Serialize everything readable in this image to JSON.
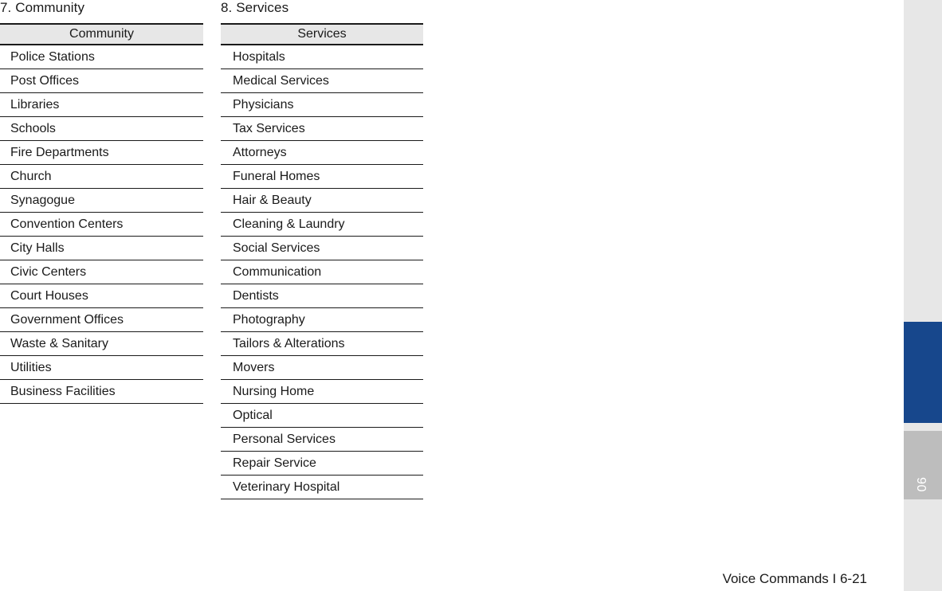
{
  "sections": [
    {
      "number_title": "7. Community",
      "table_header": "Community",
      "rows": [
        "Police Stations",
        "Post Offices",
        "Libraries",
        "Schools",
        "Fire Departments",
        "Church",
        "Synagogue",
        "Convention Centers",
        "City Halls",
        "Civic Centers",
        "Court Houses",
        "Government Offices",
        "Waste & Sanitary",
        "Utilities",
        "Business Facilities"
      ]
    },
    {
      "number_title": "8. Services",
      "table_header": "Services",
      "rows": [
        "Hospitals",
        "Medical Services",
        "Physicians",
        "Tax Services",
        "Attorneys",
        "Funeral Homes",
        "Hair & Beauty",
        "Cleaning & Laundry",
        "Social Services",
        "Communication",
        "Dentists",
        "Photography",
        "Tailors & Alterations",
        "Movers",
        "Nursing Home",
        "Optical",
        "Personal Services",
        "Repair Service",
        "Veterinary Hospital"
      ]
    }
  ],
  "sidebar": {
    "chapter_number": "06",
    "accent_color": "#17478c",
    "tab_gray_color": "#bdbdbd",
    "background_color": "#e7e7e7"
  },
  "footer": {
    "text": "Voice Commands I 6-21"
  }
}
